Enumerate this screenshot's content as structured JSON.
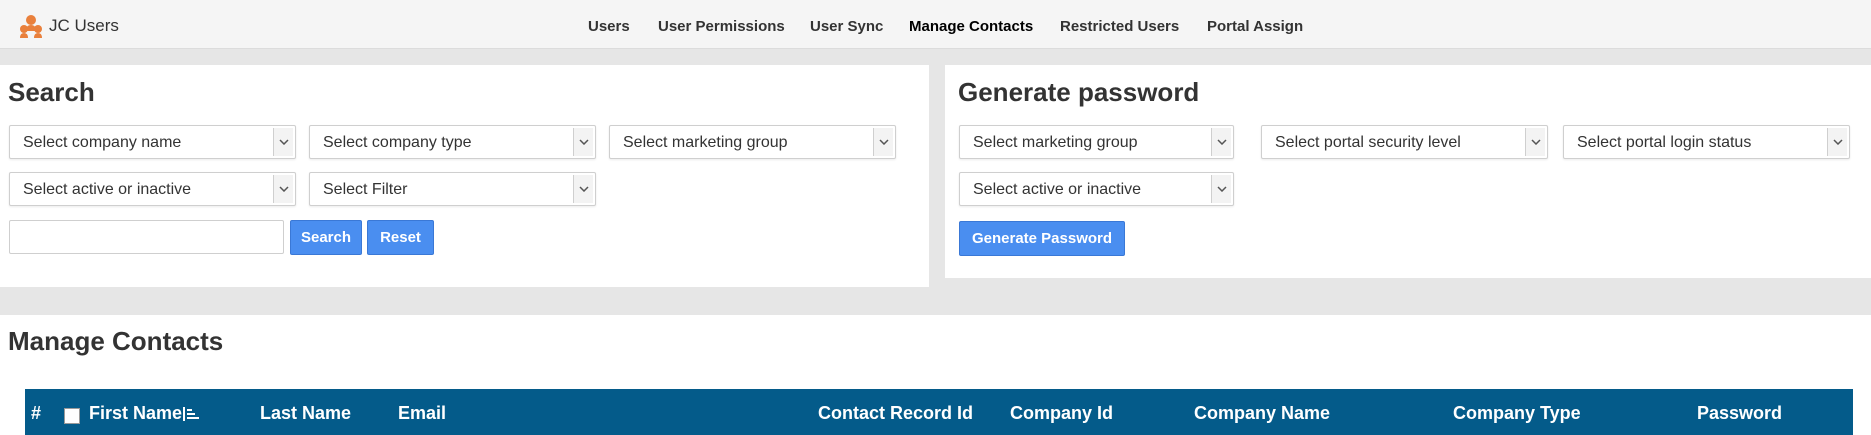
{
  "app": {
    "title": "JC Users",
    "brand_icon": "users-icon",
    "brand_color": "#e9803c"
  },
  "nav": {
    "items": [
      {
        "label": "Users"
      },
      {
        "label": "User Permissions"
      },
      {
        "label": "User Sync"
      },
      {
        "label": "Manage Contacts",
        "active": true
      },
      {
        "label": "Restricted Users"
      },
      {
        "label": "Portal Assign"
      }
    ]
  },
  "search": {
    "title": "Search",
    "company_name": "Select company name",
    "company_type": "Select company type",
    "marketing_group": "Select marketing group",
    "active_status": "Select active or inactive",
    "filter": "Select Filter",
    "keyword_value": "",
    "search_label": "Search",
    "reset_label": "Reset"
  },
  "generate": {
    "title": "Generate password",
    "marketing_group": "Select marketing group",
    "security_level": "Select portal security level",
    "login_status": "Select portal login status",
    "active_status": "Select active or inactive",
    "button_label": "Generate Password"
  },
  "contacts": {
    "title": "Manage Contacts",
    "columns": {
      "index": "#",
      "first_name": "First Name",
      "last_name": "Last Name",
      "email": "Email",
      "contact_record_id": "Contact Record Id",
      "company_id": "Company Id",
      "company_name": "Company Name",
      "company_type": "Company Type",
      "password": "Password"
    },
    "sort_icon": "sort-ascending-icon",
    "header_color": "#045b8a"
  },
  "colors": {
    "accent": "#4a8ef0"
  }
}
